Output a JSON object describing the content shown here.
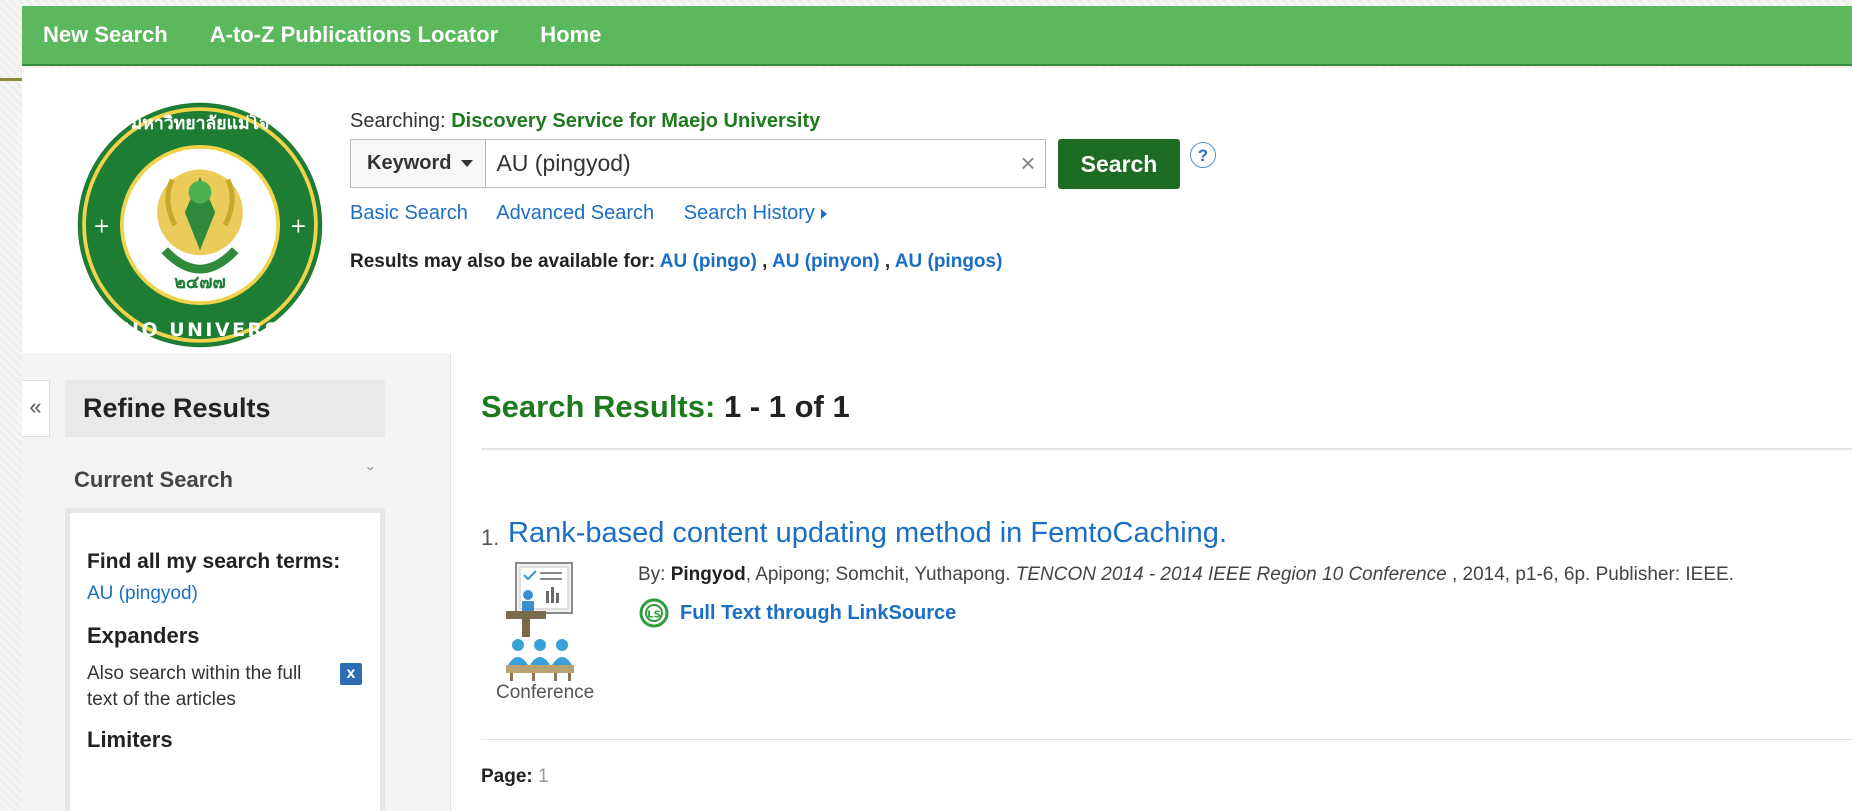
{
  "topnav": {
    "items": [
      "New Search",
      "A-to-Z Publications Locator",
      "Home"
    ]
  },
  "header": {
    "searching_label": "Searching:",
    "service_name": "Discovery Service for Maejo University",
    "field_selector": "Keyword",
    "query": "AU (pingyod)",
    "clear_label": "×",
    "search_button": "Search",
    "help_label": "?",
    "links": {
      "basic": "Basic Search",
      "advanced": "Advanced Search",
      "history": "Search History"
    },
    "also_label": "Results may also be available for:",
    "suggestions": [
      "AU (pingo)",
      "AU (pinyon)",
      "AU (pingos)"
    ],
    "separator": ","
  },
  "sidebar": {
    "collapse_label": "«",
    "refine_title": "Refine Results",
    "current_search_label": "Current Search",
    "chevron": "ˇ",
    "find_all_label": "Find all my search terms:",
    "find_all_value": "AU (pingyod)",
    "expanders_label": "Expanders",
    "expander_text": "Also search within the full text of the articles",
    "expander_remove": "x",
    "limiters_label": "Limiters"
  },
  "results": {
    "title_label": "Search Results:",
    "count_text": "1 - 1 of 1",
    "items": [
      {
        "number": "1.",
        "title": "Rank-based content updating method in FemtoCaching.",
        "by_label": "By:",
        "author_bold": "Pingyod",
        "authors_rest": ", Apipong; Somchit, Yuthapong.",
        "source_italic": "TENCON 2014 - 2014 IEEE Region 10 Conference",
        "details": ", 2014, p1-6, 6p. Publisher: IEEE.",
        "type_label": "Conference",
        "type_icon": "conference-icon",
        "fulltext_label": "Full Text through LinkSource",
        "fulltext_icon": "linksource-icon"
      }
    ],
    "page_label": "Page:",
    "page_number": "1"
  },
  "colors": {
    "topbar": "#5cb85c",
    "search_button": "#1e6b23",
    "link": "#1a6ec6",
    "title_green": "#1e7a1e"
  }
}
